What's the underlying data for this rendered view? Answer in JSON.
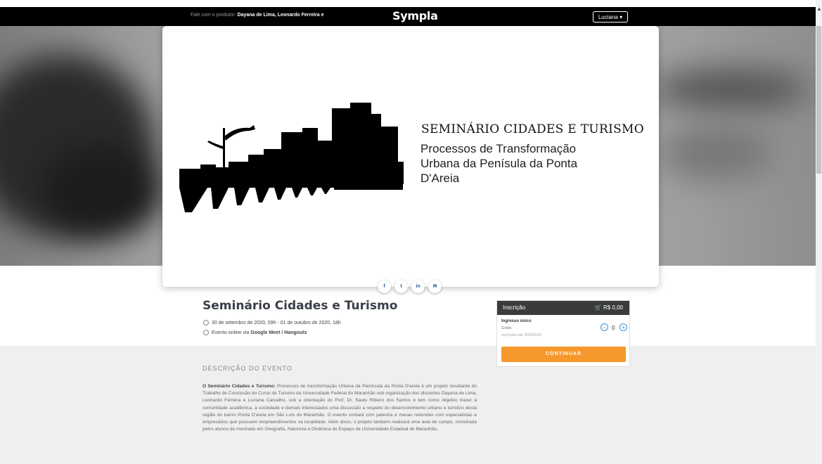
{
  "header": {
    "contact_label": "Fale com o produtor:",
    "contact_names": "Dayana de Lima, Leonardo Ferreira e",
    "logo": "Sympla",
    "user_menu": "Luciana ▾"
  },
  "banner": {
    "title": "SEMINÁRIO CIDADES E TURISMO",
    "subtitle_lines": [
      "Processos de Transformação",
      "Urbana da Penísula da Ponta",
      "D'Areia"
    ]
  },
  "share": {
    "icons": [
      "facebook-icon",
      "twitter-icon",
      "linkedin-icon",
      "email-icon"
    ],
    "labels": [
      "f",
      "t",
      "in",
      "✉"
    ]
  },
  "event": {
    "title": "Seminário Cidades e Turismo",
    "date": "30 de setembro de 2020, 09h - 01 de outubro de 2020, 18h",
    "location_prefix": "Evento online via ",
    "location_platform": "Google Meet / Hangouts"
  },
  "description": {
    "heading": "DESCRIÇÃO DO EVENTO",
    "lead": "O Seminário Cidades e Turismo:",
    "body": " Processos de transformação Urbana da Península da Ponta D'areia é um projeto resultante do Trabalho de Conclusão do Curso de Turismo da Universidade Federal do Maranhão sob organização dos discentes Dayana de Lima, Leonardo Ferreira e Luciana Carvalho, sob a orientação do Prof. Dr. Saulo Ribeiro dos Santos e tem como objetivo trazer à comunidade acadêmica, à sociedade e demais interessados uma discussão a respeito do desenvolvimento urbano e turístico desta região do bairro Ponta D'areia em São Luís do Maranhão. O evento contará com palestra e mesas redondas com especialistas e empresários que possuem empreendimentos na localidade. Além disso, o projeto também realizará uma aula de campo, ministrada pelos alunos do mestrado em Geografia, Natureza e Dinâmica do Espaço da Universidade Estadual do Maranhão."
  },
  "ticket": {
    "header": "Inscrição",
    "total": "🛒 R$ 0,00",
    "name": "Ingresso único",
    "price": "Grátis",
    "deadline": "Inscrições até 30/09/2020",
    "minus": "−",
    "plus": "+",
    "quantity": "0",
    "continue": "CONTINUAR"
  },
  "colors": {
    "topbar": "#000000",
    "accent_orange": "#f6982b",
    "accent_blue": "#3c8fd8",
    "ticket_header": "#3b3b3b"
  }
}
